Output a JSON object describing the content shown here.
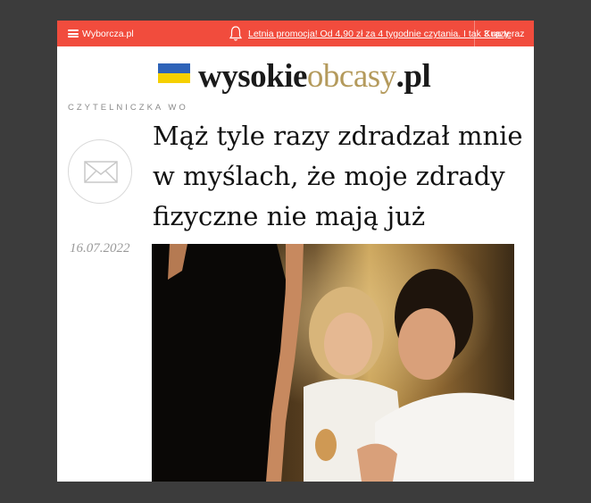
{
  "topbar": {
    "site_link": "Wyborcza.pl",
    "promo_text": "Letnia promocja! Od 4,90 zł za 4 tygodnie czytania. I tak 3 razy.",
    "buy_label": "Kup teraz",
    "accent_color": "#f14c3d",
    "icons": [
      "hamburger-menu-icon",
      "bell-icon"
    ]
  },
  "header": {
    "logo_part1": "wysokie",
    "logo_part2": "obcasy",
    "logo_part3": ".pl"
  },
  "article": {
    "rubric": "Czytelniczka WO",
    "title": "Mąż tyle razy zdradzał mnie w myślach, że moje zdrady fizyczne nie mają już znaczenia",
    "date": "16.07.2022",
    "author_icon": "envelope-icon"
  }
}
